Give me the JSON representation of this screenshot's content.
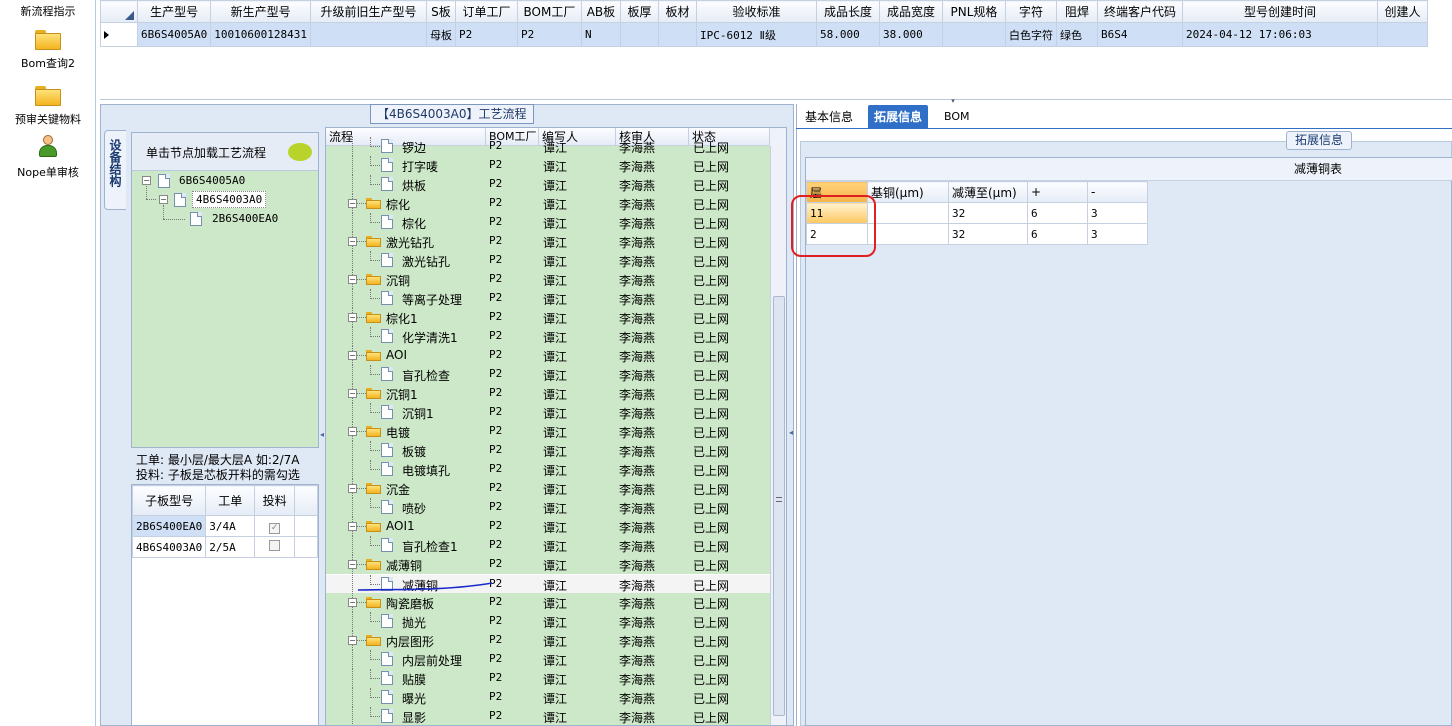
{
  "left_nav": {
    "items": [
      {
        "label": "新流程指示"
      },
      {
        "label": "Bom查询2"
      },
      {
        "label": "预审关键物料"
      },
      {
        "label": "Nope单审核"
      }
    ]
  },
  "top_grid": {
    "columns": [
      "生产型号",
      "新生产型号",
      "升级前旧生产型号",
      "S板",
      "订单工厂",
      "BOM工厂",
      "AB板",
      "板厚",
      "板材",
      "验收标准",
      "成品长度",
      "成品宽度",
      "PNL规格",
      "字符",
      "阻焊",
      "终端客户代码",
      "型号创建时间",
      "创建人"
    ],
    "row": [
      "6B6S4005A0",
      "10010600128431",
      "",
      "母板",
      "P2",
      "P2",
      "N",
      "",
      "",
      "IPC-6012 Ⅱ级",
      "58.000",
      "38.000",
      "",
      "白色字符",
      "绿色",
      "B6S4",
      "2024-04-12 17:06:03",
      ""
    ]
  },
  "process_panel": {
    "title": "【4B6S4003A0】工艺流程",
    "side_tab": "设备结构",
    "hint": "单击节点加载工艺流程",
    "tree": [
      "6B6S4005A0",
      "4B6S4003A0",
      "2B6S400EA0"
    ],
    "note_line1": "工单: 最小层/最大层A 如:2/7A",
    "note_line2": "投料: 子板是芯板开料的需勾选",
    "sub_board_table": {
      "columns": [
        "子板型号",
        "工单",
        "投料"
      ],
      "rows": [
        {
          "model": "2B6S400EA0",
          "order": "3/4A",
          "feed": true
        },
        {
          "model": "4B6S4003A0",
          "order": "2/5A",
          "feed": false
        }
      ]
    }
  },
  "flow_grid": {
    "columns": [
      "流程",
      "BOM工厂",
      "编写人",
      "核审人",
      "状态"
    ],
    "rows": [
      {
        "kind": "step",
        "name": "锣边",
        "factory": "P2",
        "writer": "谭江",
        "reviewer": "李海燕",
        "status": "已上网"
      },
      {
        "kind": "step",
        "name": "打字唛",
        "factory": "P2",
        "writer": "谭江",
        "reviewer": "李海燕",
        "status": "已上网"
      },
      {
        "kind": "step",
        "name": "烘板",
        "factory": "P2",
        "writer": "谭江",
        "reviewer": "李海燕",
        "status": "已上网"
      },
      {
        "kind": "group",
        "name": "棕化",
        "factory": "P2",
        "writer": "谭江",
        "reviewer": "李海燕",
        "status": "已上网"
      },
      {
        "kind": "step",
        "name": "棕化",
        "factory": "P2",
        "writer": "谭江",
        "reviewer": "李海燕",
        "status": "已上网"
      },
      {
        "kind": "group",
        "name": "激光钻孔",
        "factory": "P2",
        "writer": "谭江",
        "reviewer": "李海燕",
        "status": "已上网"
      },
      {
        "kind": "step",
        "name": "激光钻孔",
        "factory": "P2",
        "writer": "谭江",
        "reviewer": "李海燕",
        "status": "已上网"
      },
      {
        "kind": "group",
        "name": "沉铜",
        "factory": "P2",
        "writer": "谭江",
        "reviewer": "李海燕",
        "status": "已上网"
      },
      {
        "kind": "step",
        "name": "等离子处理",
        "factory": "P2",
        "writer": "谭江",
        "reviewer": "李海燕",
        "status": "已上网"
      },
      {
        "kind": "group",
        "name": "棕化1",
        "factory": "P2",
        "writer": "谭江",
        "reviewer": "李海燕",
        "status": "已上网"
      },
      {
        "kind": "step",
        "name": "化学清洗1",
        "factory": "P2",
        "writer": "谭江",
        "reviewer": "李海燕",
        "status": "已上网"
      },
      {
        "kind": "group",
        "name": "AOI",
        "factory": "P2",
        "writer": "谭江",
        "reviewer": "李海燕",
        "status": "已上网"
      },
      {
        "kind": "step",
        "name": "盲孔检查",
        "factory": "P2",
        "writer": "谭江",
        "reviewer": "李海燕",
        "status": "已上网"
      },
      {
        "kind": "group",
        "name": "沉铜1",
        "factory": "P2",
        "writer": "谭江",
        "reviewer": "李海燕",
        "status": "已上网"
      },
      {
        "kind": "step",
        "name": "沉铜1",
        "factory": "P2",
        "writer": "谭江",
        "reviewer": "李海燕",
        "status": "已上网"
      },
      {
        "kind": "group",
        "name": "电镀",
        "factory": "P2",
        "writer": "谭江",
        "reviewer": "李海燕",
        "status": "已上网"
      },
      {
        "kind": "step",
        "name": "板镀",
        "factory": "P2",
        "writer": "谭江",
        "reviewer": "李海燕",
        "status": "已上网"
      },
      {
        "kind": "step",
        "name": "电镀填孔",
        "factory": "P2",
        "writer": "谭江",
        "reviewer": "李海燕",
        "status": "已上网"
      },
      {
        "kind": "group",
        "name": "沉金",
        "factory": "P2",
        "writer": "谭江",
        "reviewer": "李海燕",
        "status": "已上网"
      },
      {
        "kind": "step",
        "name": "喷砂",
        "factory": "P2",
        "writer": "谭江",
        "reviewer": "李海燕",
        "status": "已上网"
      },
      {
        "kind": "group",
        "name": "AOI1",
        "factory": "P2",
        "writer": "谭江",
        "reviewer": "李海燕",
        "status": "已上网"
      },
      {
        "kind": "step",
        "name": "盲孔检查1",
        "factory": "P2",
        "writer": "谭江",
        "reviewer": "李海燕",
        "status": "已上网"
      },
      {
        "kind": "group",
        "name": "减薄铜",
        "factory": "P2",
        "writer": "谭江",
        "reviewer": "李海燕",
        "status": "已上网"
      },
      {
        "kind": "step",
        "name": "减薄铜",
        "factory": "P2",
        "writer": "谭江",
        "reviewer": "李海燕",
        "status": "已上网",
        "selected": true
      },
      {
        "kind": "group",
        "name": "陶瓷磨板",
        "factory": "P2",
        "writer": "谭江",
        "reviewer": "李海燕",
        "status": "已上网"
      },
      {
        "kind": "step",
        "name": "抛光",
        "factory": "P2",
        "writer": "谭江",
        "reviewer": "李海燕",
        "status": "已上网"
      },
      {
        "kind": "group",
        "name": "内层图形",
        "factory": "P2",
        "writer": "谭江",
        "reviewer": "李海燕",
        "status": "已上网"
      },
      {
        "kind": "step",
        "name": "内层前处理",
        "factory": "P2",
        "writer": "谭江",
        "reviewer": "李海燕",
        "status": "已上网"
      },
      {
        "kind": "step",
        "name": "贴膜",
        "factory": "P2",
        "writer": "谭江",
        "reviewer": "李海燕",
        "status": "已上网"
      },
      {
        "kind": "step",
        "name": "曝光",
        "factory": "P2",
        "writer": "谭江",
        "reviewer": "李海燕",
        "status": "已上网"
      },
      {
        "kind": "step",
        "name": "显影",
        "factory": "P2",
        "writer": "谭江",
        "reviewer": "李海燕",
        "status": "已上网"
      }
    ]
  },
  "right_panel": {
    "tabs": [
      {
        "label": "基本信息",
        "active": false
      },
      {
        "label": "拓展信息",
        "active": true
      },
      {
        "label": "BOM",
        "active": false
      }
    ],
    "group_title": "拓展信息",
    "table_title": "减薄铜表",
    "table": {
      "columns": [
        "层",
        "基铜(μm)",
        "减薄至(μm)",
        "+",
        "-"
      ],
      "rows": [
        [
          "11",
          "",
          "32",
          "6",
          "3"
        ],
        [
          "2",
          "",
          "32",
          "6",
          "3"
        ]
      ]
    }
  },
  "colors": {
    "selection_blue": "#cfe0f6",
    "tab_active": "#2f6fc8",
    "flow_green": "#cde8c8",
    "annotation_red": "#e02020",
    "annotation_blue": "#1a2cc8"
  }
}
